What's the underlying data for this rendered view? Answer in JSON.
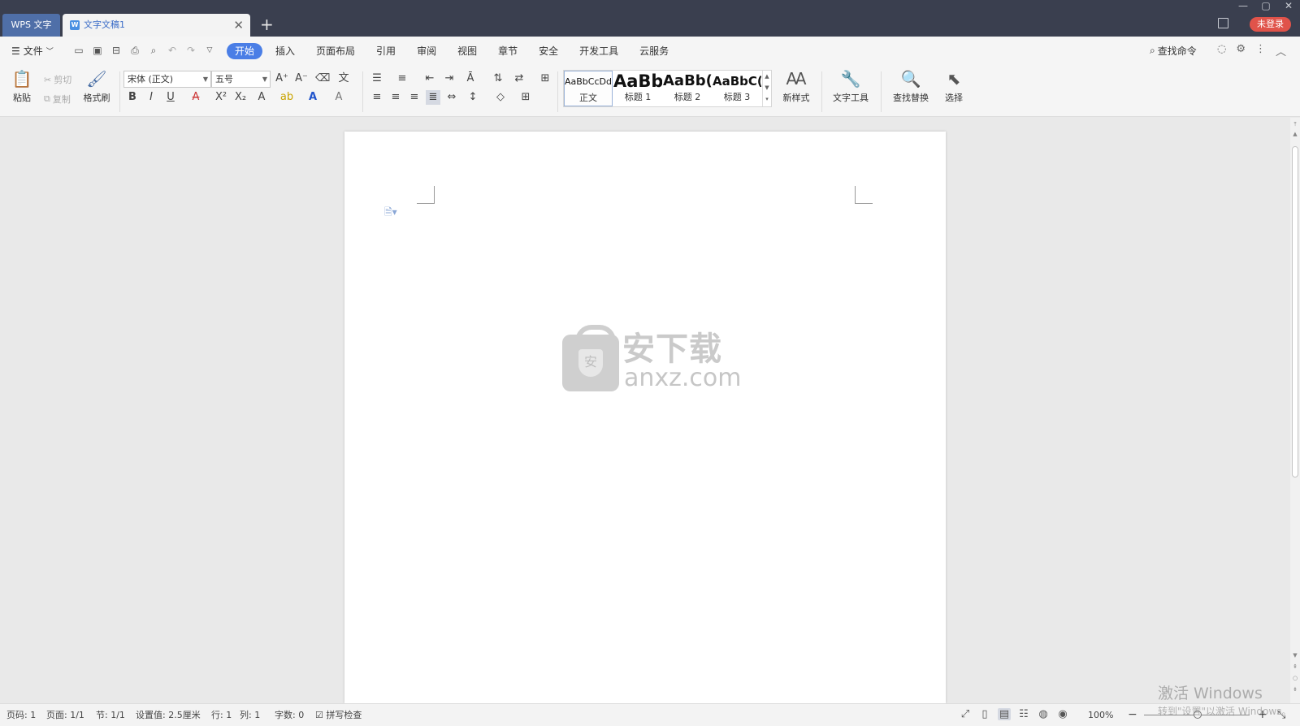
{
  "titlebar": {
    "app_tab": "WPS 文字",
    "doc_tab_title": "文字文稿1",
    "new_tab": "+",
    "login": "未登录",
    "min": "—",
    "max": "▢",
    "close": "✕",
    "tab_close": "✕"
  },
  "menubar": {
    "file_label": "文件",
    "tabs": [
      {
        "label": "开始",
        "active": true
      },
      {
        "label": "插入"
      },
      {
        "label": "页面布局"
      },
      {
        "label": "引用"
      },
      {
        "label": "审阅"
      },
      {
        "label": "视图"
      },
      {
        "label": "章节"
      },
      {
        "label": "安全"
      },
      {
        "label": "开发工具"
      },
      {
        "label": "云服务"
      }
    ],
    "search_label": "查找命令"
  },
  "ribbon": {
    "paste": "粘贴",
    "cut": "剪切",
    "copy": "复制",
    "format_painter": "格式刷",
    "font_name": "宋体 (正文)",
    "font_size": "五号",
    "styles": [
      {
        "sample": "AaBbCcDd",
        "name": "正文"
      },
      {
        "sample": "AaBb",
        "name": "标题 1"
      },
      {
        "sample": "AaBb(",
        "name": "标题 2"
      },
      {
        "sample": "AaBbC(",
        "name": "标题 3"
      }
    ],
    "new_style": "新样式",
    "text_tools": "文字工具",
    "find_replace": "查找替换",
    "select": "选择"
  },
  "watermark": {
    "cn": "安下载",
    "en": "anxz.com",
    "shield": "安"
  },
  "statusbar": {
    "page_num": "页码: 1",
    "pages": "页面: 1/1",
    "section": "节: 1/1",
    "setting": "设置值: 2.5厘米",
    "row": "行: 1",
    "col": "列: 1",
    "words": "字数: 0",
    "spell": "拼写检查",
    "zoom": "100%"
  },
  "activation": {
    "line1": "激活 Windows",
    "line2": "转到\"设置\"以激活 Windows。"
  },
  "colors": {
    "titlebar": "#3a3f4f",
    "accent": "#4a7ee6",
    "login": "#e0534a"
  }
}
